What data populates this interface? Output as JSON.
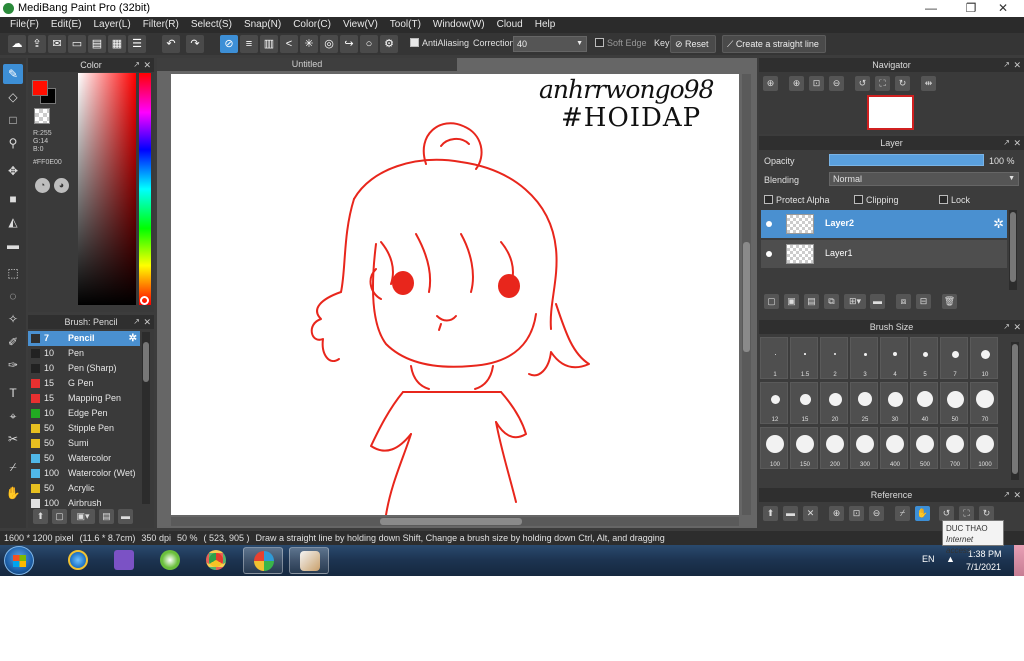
{
  "window": {
    "title": "MediBang Paint Pro (32bit)",
    "minimize": "—",
    "restore": "❐",
    "close": "✕"
  },
  "menu": [
    "File(F)",
    "Edit(E)",
    "Layer(L)",
    "Filter(R)",
    "Select(S)",
    "Snap(N)",
    "Color(C)",
    "View(V)",
    "Tool(T)",
    "Window(W)",
    "Cloud",
    "Help"
  ],
  "toolbar": {
    "antialiasing_label": "AntiAliasing",
    "correction_label": "Correction",
    "correction_value": "40",
    "soft_edge_label": "Soft Edge",
    "key_label": "Key",
    "reset_label": "Reset",
    "straight_line_label": "Create a straight line"
  },
  "color_panel": {
    "title": "Color",
    "foreground": "#FF0E00",
    "r": "R:255",
    "g": "G:14",
    "b": "B:0",
    "hex": "#FF0E00"
  },
  "brush_panel": {
    "title": "Brush: Pencil",
    "items": [
      {
        "size": "7",
        "name": "Pencil",
        "color": "#2f2f2f",
        "selected": true
      },
      {
        "size": "10",
        "name": "Pen",
        "color": "#222222"
      },
      {
        "size": "10",
        "name": "Pen (Sharp)",
        "color": "#222222"
      },
      {
        "size": "15",
        "name": "G Pen",
        "color": "#e83030"
      },
      {
        "size": "15",
        "name": "Mapping Pen",
        "color": "#e83030"
      },
      {
        "size": "10",
        "name": "Edge Pen",
        "color": "#22aa22"
      },
      {
        "size": "50",
        "name": "Stipple Pen",
        "color": "#e8c020"
      },
      {
        "size": "50",
        "name": "Sumi",
        "color": "#e8c020"
      },
      {
        "size": "50",
        "name": "Watercolor",
        "color": "#50b8e8"
      },
      {
        "size": "100",
        "name": "Watercolor (Wet)",
        "color": "#50b8e8"
      },
      {
        "size": "50",
        "name": "Acrylic",
        "color": "#e8c020"
      },
      {
        "size": "100",
        "name": "Airbrush",
        "color": "#e0e0e0"
      }
    ]
  },
  "canvas": {
    "tab_title": "Untitled",
    "handwriting_line1": "anhrrwongo98",
    "handwriting_line2": "#HOIDAP",
    "stroke_color": "#e8261c"
  },
  "navigator": {
    "title": "Navigator"
  },
  "layer_panel": {
    "title": "Layer",
    "opacity_label": "Opacity",
    "opacity_value": "100 %",
    "blending_label": "Blending",
    "blending_value": "Normal",
    "protect_alpha_label": "Protect Alpha",
    "clipping_label": "Clipping",
    "lock_label": "Lock",
    "layers": [
      {
        "name": "Layer2",
        "selected": true
      },
      {
        "name": "Layer1",
        "selected": false
      }
    ]
  },
  "brush_size_panel": {
    "title": "Brush Size",
    "sizes": [
      "1",
      "1.5",
      "2",
      "3",
      "4",
      "5",
      "7",
      "10",
      "12",
      "15",
      "20",
      "25",
      "30",
      "40",
      "50",
      "70",
      "100",
      "150",
      "200",
      "300",
      "400",
      "500",
      "700",
      "1000"
    ]
  },
  "reference_panel": {
    "title": "Reference"
  },
  "status": {
    "image_size": "1600 * 1200 pixel",
    "physical_size": "(11.6 * 8.7cm)",
    "dpi": "350 dpi",
    "zoom": "50 %",
    "cursor": "( 523, 905 )",
    "hint": "Draw a straight line by holding down Shift, Change a brush size by holding down Ctrl, Alt, and dragging"
  },
  "taskbar": {
    "language": "EN",
    "time": "1:38 PM",
    "date": "7/1/2021",
    "tooltip_title": "DUC THAO",
    "tooltip_subtitle": "Internet access"
  }
}
